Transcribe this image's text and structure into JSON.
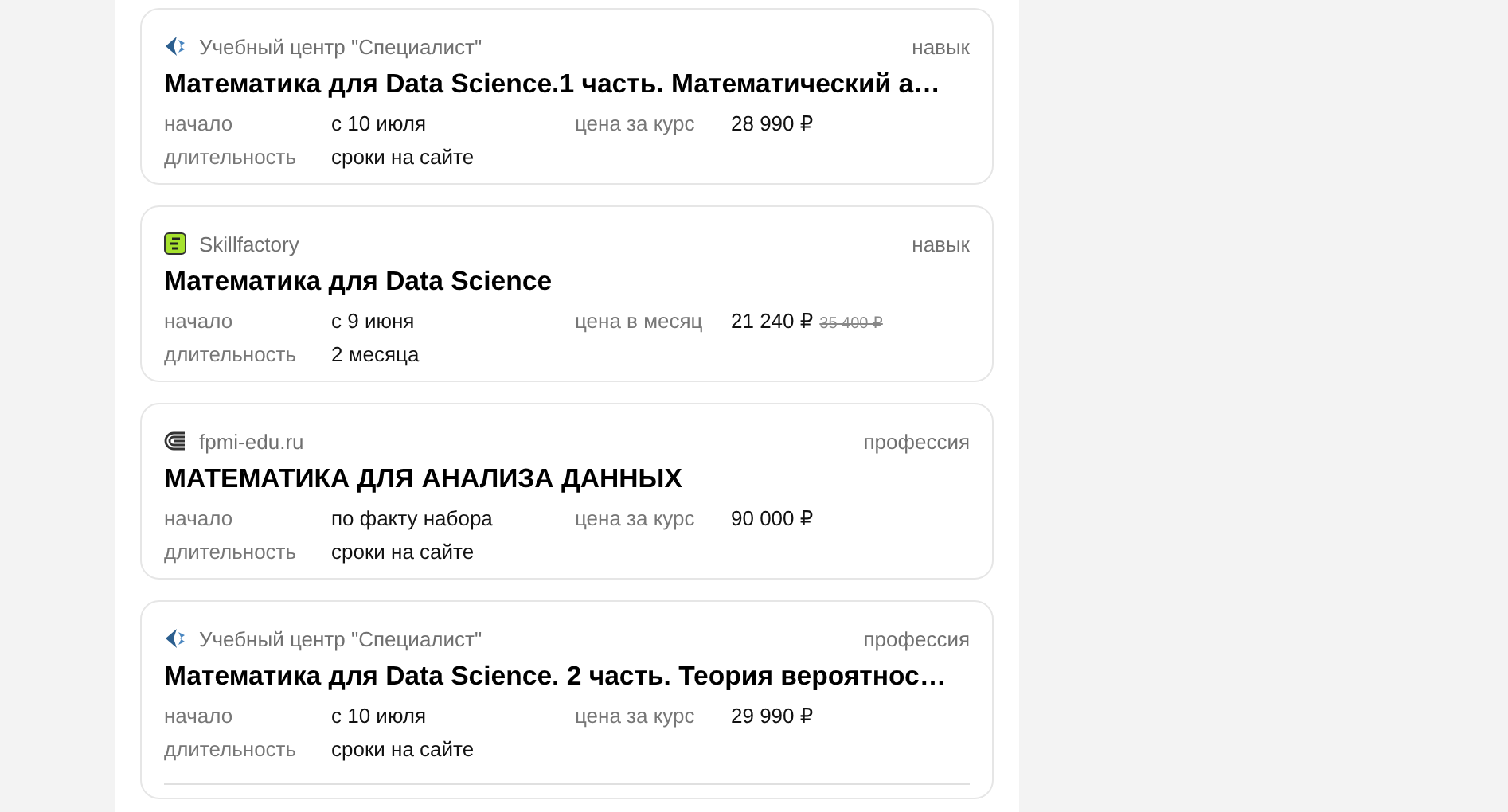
{
  "courses": [
    {
      "provider": {
        "name": "Учебный центр \"Специалист\"",
        "kind": "specialist"
      },
      "tag": "навык",
      "title": "Математика для Data Science.1 часть. Математический а…",
      "start_label": "начало",
      "start": "с 10 июля",
      "price_label": "цена за курс",
      "price": "28 990 ₽",
      "duration_label": "длительность",
      "duration": "сроки на сайте",
      "divider": false
    },
    {
      "provider": {
        "name": "Skillfactory",
        "kind": "skillfactory"
      },
      "tag": "навык",
      "title": "Математика для Data Science",
      "start_label": "начало",
      "start": "с 9 июня",
      "price_label": "цена в месяц",
      "price": "21 240 ₽",
      "old_price": "35 400 ₽",
      "duration_label": "длительность",
      "duration": "2 месяца",
      "divider": false
    },
    {
      "provider": {
        "name": "fpmi-edu.ru",
        "kind": "fpmi"
      },
      "tag": "профессия",
      "title": "МАТЕМАТИКА ДЛЯ АНАЛИЗА ДАННЫХ",
      "start_label": "начало",
      "start": "по факту набора",
      "price_label": "цена за курс",
      "price": "90 000 ₽",
      "duration_label": "длительность",
      "duration": "сроки на сайте",
      "divider": false
    },
    {
      "provider": {
        "name": "Учебный центр \"Специалист\"",
        "kind": "specialist"
      },
      "tag": "профессия",
      "title": "Математика для Data Science. 2 часть. Теория вероятнос…",
      "start_label": "начало",
      "start": "с 10 июля",
      "price_label": "цена за курс",
      "price": "29 990 ₽",
      "duration_label": "длительность",
      "duration": "сроки на сайте",
      "divider": true
    }
  ]
}
